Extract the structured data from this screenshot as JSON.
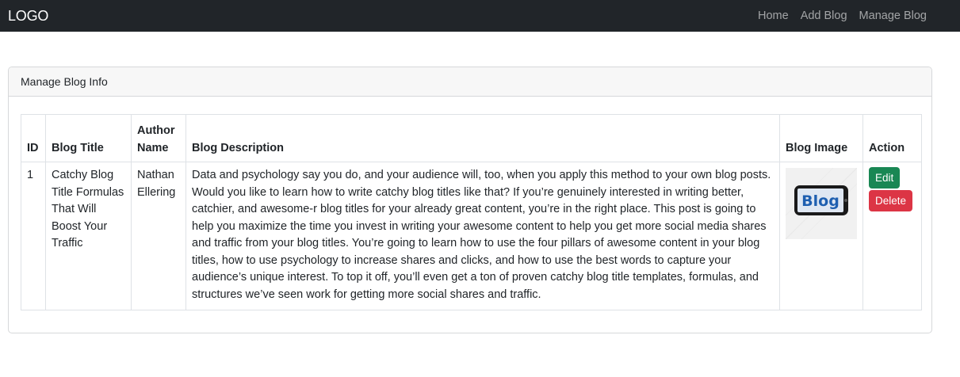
{
  "navbar": {
    "brand": "LOGO",
    "links": [
      "Home",
      "Add Blog",
      "Manage Blog"
    ]
  },
  "card": {
    "title": "Manage Blog Info"
  },
  "table": {
    "headers": {
      "id": "ID",
      "title": "Blog Title",
      "author_line1": "Author",
      "author_line2": "Name",
      "description": "Blog Description",
      "image": "Blog Image",
      "action": "Action"
    },
    "rows": [
      {
        "id": "1",
        "title": "Catchy Blog Title Formulas That Will Boost Your Traffic",
        "author": "Nathan Ellering",
        "description": "Data and psychology say you do, and your audience will, too, when you apply this method to your own blog posts. Would you like to learn how to write catchy blog titles like that? If you’re genuinely interested in writing better, catchier, and awesome-r blog titles for your already great content, you’re in the right place. This post is going to help you maximize the time you invest in writing your awesome content to help you get more social media shares and traffic from your blog titles. You’re going to learn how to use the four pillars of awesome content in your blog titles, how to use psychology to increase shares and clicks, and how to use the best words to capture your audience’s unique interest. To top it off, you’ll even get a ton of proven catchy blog title templates, formulas, and structures we’ve seen work for getting more social shares and traffic.",
        "image_text": "Blog",
        "edit_label": "Edit",
        "delete_label": "Delete"
      }
    ]
  },
  "colors": {
    "navbar_bg": "#212529",
    "edit": "#198754",
    "delete": "#dc3545",
    "blog_logo_blue": "#1e5fb0"
  },
  "icons": {
    "blog_image": "blog-phone-logo"
  }
}
